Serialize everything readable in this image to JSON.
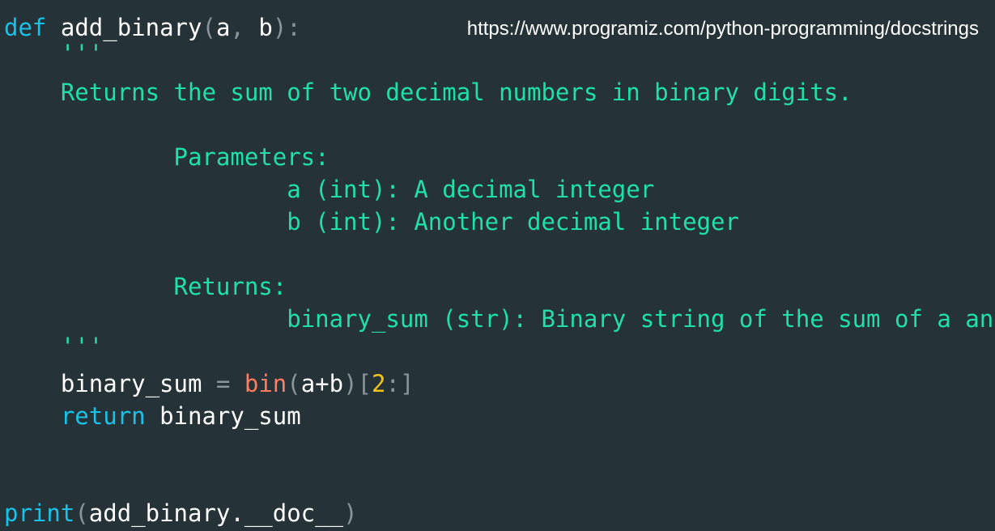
{
  "source_url": "https://www.programiz.com/python-programming/docstrings",
  "code": {
    "def_kw": "def",
    "func_name": "add_binary",
    "paren_open": "(",
    "param_a": "a",
    "comma": ",",
    "param_b": "b",
    "paren_close_colon": "):",
    "doc_open_quotes": "'''",
    "doc_summary": "Returns the sum of two decimal numbers in binary digits.",
    "doc_params_header": "Parameters:",
    "doc_param_a": "a (int): A decimal integer",
    "doc_param_b": "b (int): Another decimal integer",
    "doc_returns_header": "Returns:",
    "doc_returns_desc": "binary_sum (str): Binary string of the sum of a and b",
    "doc_close_quotes": "'''",
    "assign_var": "binary_sum",
    "assign_op": "=",
    "bin_builtin": "bin",
    "bin_paren_open": "(",
    "bin_arg": "a+b",
    "bin_paren_close": ")",
    "slice_open": "[",
    "slice_num": "2",
    "slice_close": ":]",
    "return_kw": "return",
    "return_value": "binary_sum",
    "print_builtin": "print",
    "print_paren_open": "(",
    "print_arg": "add_binary.__doc__",
    "print_paren_close": ")"
  },
  "colors": {
    "background": "#253238",
    "keyword": "#19c2e6",
    "docstring": "#1fe0a8",
    "builtin": "#ff7e63",
    "number": "#f2c31b",
    "punctuation": "#8a949b",
    "text": "#ffffff"
  }
}
